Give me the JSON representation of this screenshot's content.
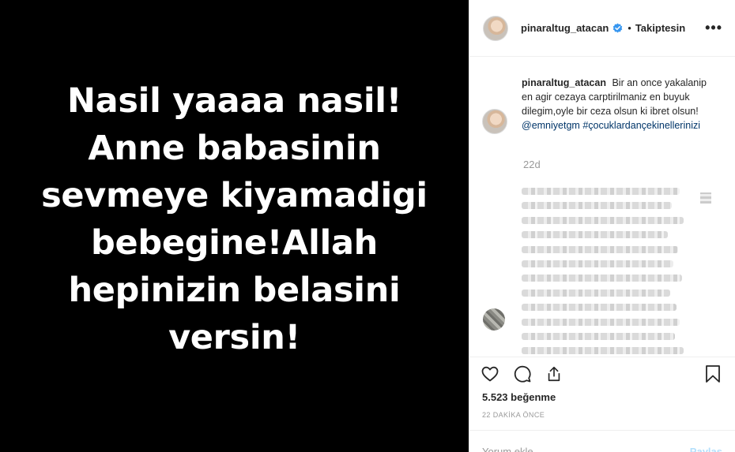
{
  "media": {
    "lines": [
      "Nasil yaaaa nasil!",
      "Anne babasinin",
      "sevmeye kiyamadigi",
      "bebegine!Allah",
      "hepinizin belasini",
      "versin!"
    ]
  },
  "header": {
    "username": "pinaraltug_atacan",
    "separator": "•",
    "follow_status": "Takiptesin",
    "more_icon": "more-options-icon"
  },
  "caption": {
    "username": "pinaraltug_atacan",
    "text": "Bir an once yakalanip en agir cezaya carptirilmaniz en buyuk dilegim,oyle bir ceza olsun ki ibret olsun!",
    "mention": "@emniyetgm",
    "hashtag": "#çocuklardançekinellerinizi"
  },
  "timestamp": "22d",
  "actions": {
    "like_icon": "heart-icon",
    "comment_icon": "comment-icon",
    "share_icon": "share-icon",
    "save_icon": "bookmark-icon"
  },
  "likes": "5.523 beğenme",
  "post_time": "22 DAKİKA ÖNCE",
  "comment": {
    "placeholder": "Yorum ekle...",
    "post_label": "Paylaş"
  },
  "colors": {
    "verified": "#3897f0",
    "link": "#003569",
    "post_button": "#b2dffc"
  }
}
